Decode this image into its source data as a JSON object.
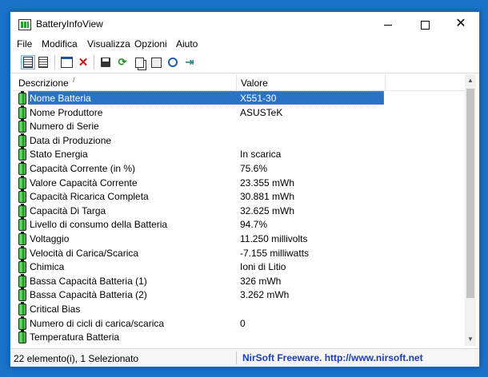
{
  "window": {
    "title": "BatteryInfoView",
    "controls": {
      "minimize": "minimize",
      "maximize": "maximize",
      "close": "✕"
    }
  },
  "menu": [
    "File",
    "Modifica",
    "Visualizza",
    "Opzioni",
    "Aiuto"
  ],
  "toolbar": {
    "icons": [
      "battery-info-view-icon",
      "battery-log-view-icon",
      "window-icon",
      "delete-icon",
      "save-icon",
      "refresh-icon",
      "copy-icon",
      "properties-icon",
      "find-icon",
      "exit-icon"
    ]
  },
  "columns": {
    "desc": "Descrizione",
    "value": "Valore",
    "sort_indicator": "/"
  },
  "rows": [
    {
      "desc": "Nome Batteria",
      "value": "X551-30",
      "selected": true
    },
    {
      "desc": "Nome Produttore",
      "value": "ASUSTeK"
    },
    {
      "desc": "Numero di Serie",
      "value": ""
    },
    {
      "desc": "Data di Produzione",
      "value": ""
    },
    {
      "desc": "Stato Energia",
      "value": "In scarica"
    },
    {
      "desc": "Capacità Corrente (in %)",
      "value": "75.6%"
    },
    {
      "desc": "Valore Capacità Corrente",
      "value": "23.355 mWh"
    },
    {
      "desc": "Capacità Ricarica Completa",
      "value": "30.881 mWh"
    },
    {
      "desc": "Capacità Di Targa",
      "value": "32.625 mWh"
    },
    {
      "desc": "Livello di consumo della Batteria",
      "value": "94.7%"
    },
    {
      "desc": "Voltaggio",
      "value": "11.250 millivolts"
    },
    {
      "desc": "Velocità di Carica/Scarica",
      "value": "-7.155 milliwatts"
    },
    {
      "desc": "Chimica",
      "value": "Ioni di Litio"
    },
    {
      "desc": "Bassa Capacità Batteria (1)",
      "value": "326 mWh"
    },
    {
      "desc": "Bassa Capacità Batteria (2)",
      "value": "3.262 mWh"
    },
    {
      "desc": "Critical Bias",
      "value": ""
    },
    {
      "desc": "Numero di cicli di carica/scarica",
      "value": "0"
    },
    {
      "desc": "Temperatura Batteria",
      "value": ""
    }
  ],
  "status": {
    "left": "22 elemento(i), 1 Selezionato",
    "right": "NirSoft Freeware.  http://www.nirsoft.net"
  },
  "colors": {
    "accent": "#2a72c6",
    "desktop": "#1a73c8",
    "link": "#1a3db8"
  }
}
